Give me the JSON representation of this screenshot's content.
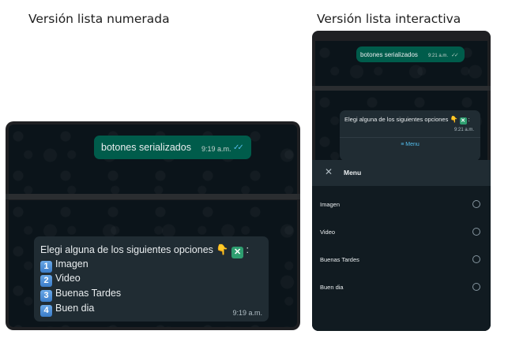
{
  "headings": {
    "left": "Versión lista numerada",
    "right": "Versión lista interactiva"
  },
  "numbered": {
    "sent": {
      "text": "botones serializados",
      "time": "9:19 a.m."
    },
    "received": {
      "prompt": "Elegi alguna de los siguientes opciones",
      "options": [
        {
          "num": "1",
          "label": "Imagen"
        },
        {
          "num": "2",
          "label": "Video"
        },
        {
          "num": "3",
          "label": "Buenas Tardes"
        },
        {
          "num": "4",
          "label": "Buen dia"
        }
      ],
      "time": "9:19 a.m."
    }
  },
  "interactive": {
    "sent": {
      "text": "botones serializados",
      "time": "9:21 a.m."
    },
    "received": {
      "prompt": "Elegi alguna de los siguientes opciones",
      "time": "9:21 a.m.",
      "button_label": "≡ Menu"
    },
    "sheet": {
      "title": "Menu",
      "options": [
        "Imagen",
        "Video",
        "Buenas Tardes",
        "Buen dia"
      ]
    }
  },
  "icons": {
    "hand": "pointing-down-hand-icon",
    "cross": "cross-mark-button-icon",
    "ticks": "double-check-icon",
    "close": "close-icon",
    "radio": "radio-button-icon"
  },
  "colors": {
    "outgoing_bubble": "#005c4b",
    "incoming_bubble": "#202c33",
    "wallpaper": "#0b141a",
    "read_ticks": "#53bdeb"
  }
}
